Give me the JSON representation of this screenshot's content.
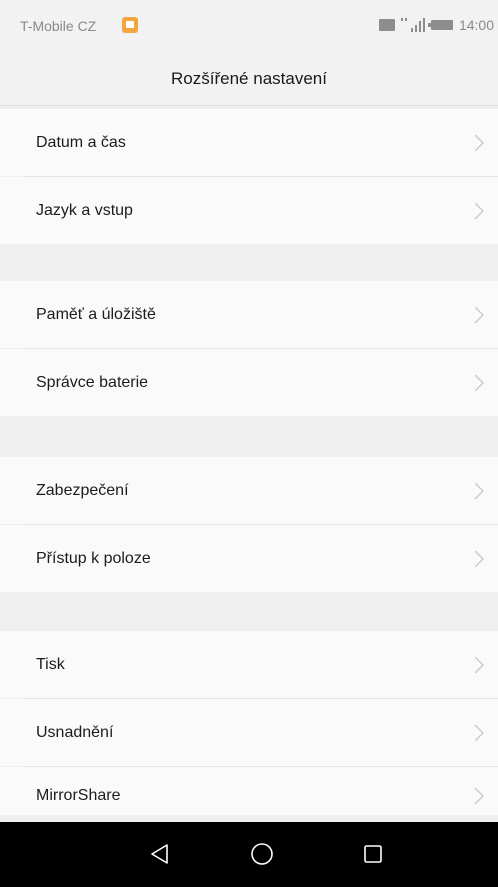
{
  "status_bar": {
    "carrier": "T-Mobile CZ",
    "time": "14:00",
    "icons": [
      "notification-icon",
      "sim-card-icon",
      "signal-icon",
      "battery-icon"
    ]
  },
  "header": {
    "title": "Rozšířené nastavení"
  },
  "groups": [
    {
      "items": [
        {
          "label": "Datum a čas"
        },
        {
          "label": "Jazyk a vstup"
        }
      ]
    },
    {
      "items": [
        {
          "label": "Paměť a úložiště"
        },
        {
          "label": "Správce baterie"
        }
      ]
    },
    {
      "items": [
        {
          "label": "Zabezpečení"
        },
        {
          "label": "Přístup k poloze"
        }
      ]
    },
    {
      "items": [
        {
          "label": "Tisk"
        },
        {
          "label": "Usnadnění"
        },
        {
          "label": "MirrorShare"
        }
      ]
    }
  ],
  "nav": {
    "buttons": [
      "back-icon",
      "home-icon",
      "recents-icon"
    ]
  },
  "colors": {
    "background": "#efefef",
    "row": "#fafafa",
    "text": "#1c1c1c",
    "chevron": "#c8c8c8",
    "nav_bar": "#000000"
  }
}
